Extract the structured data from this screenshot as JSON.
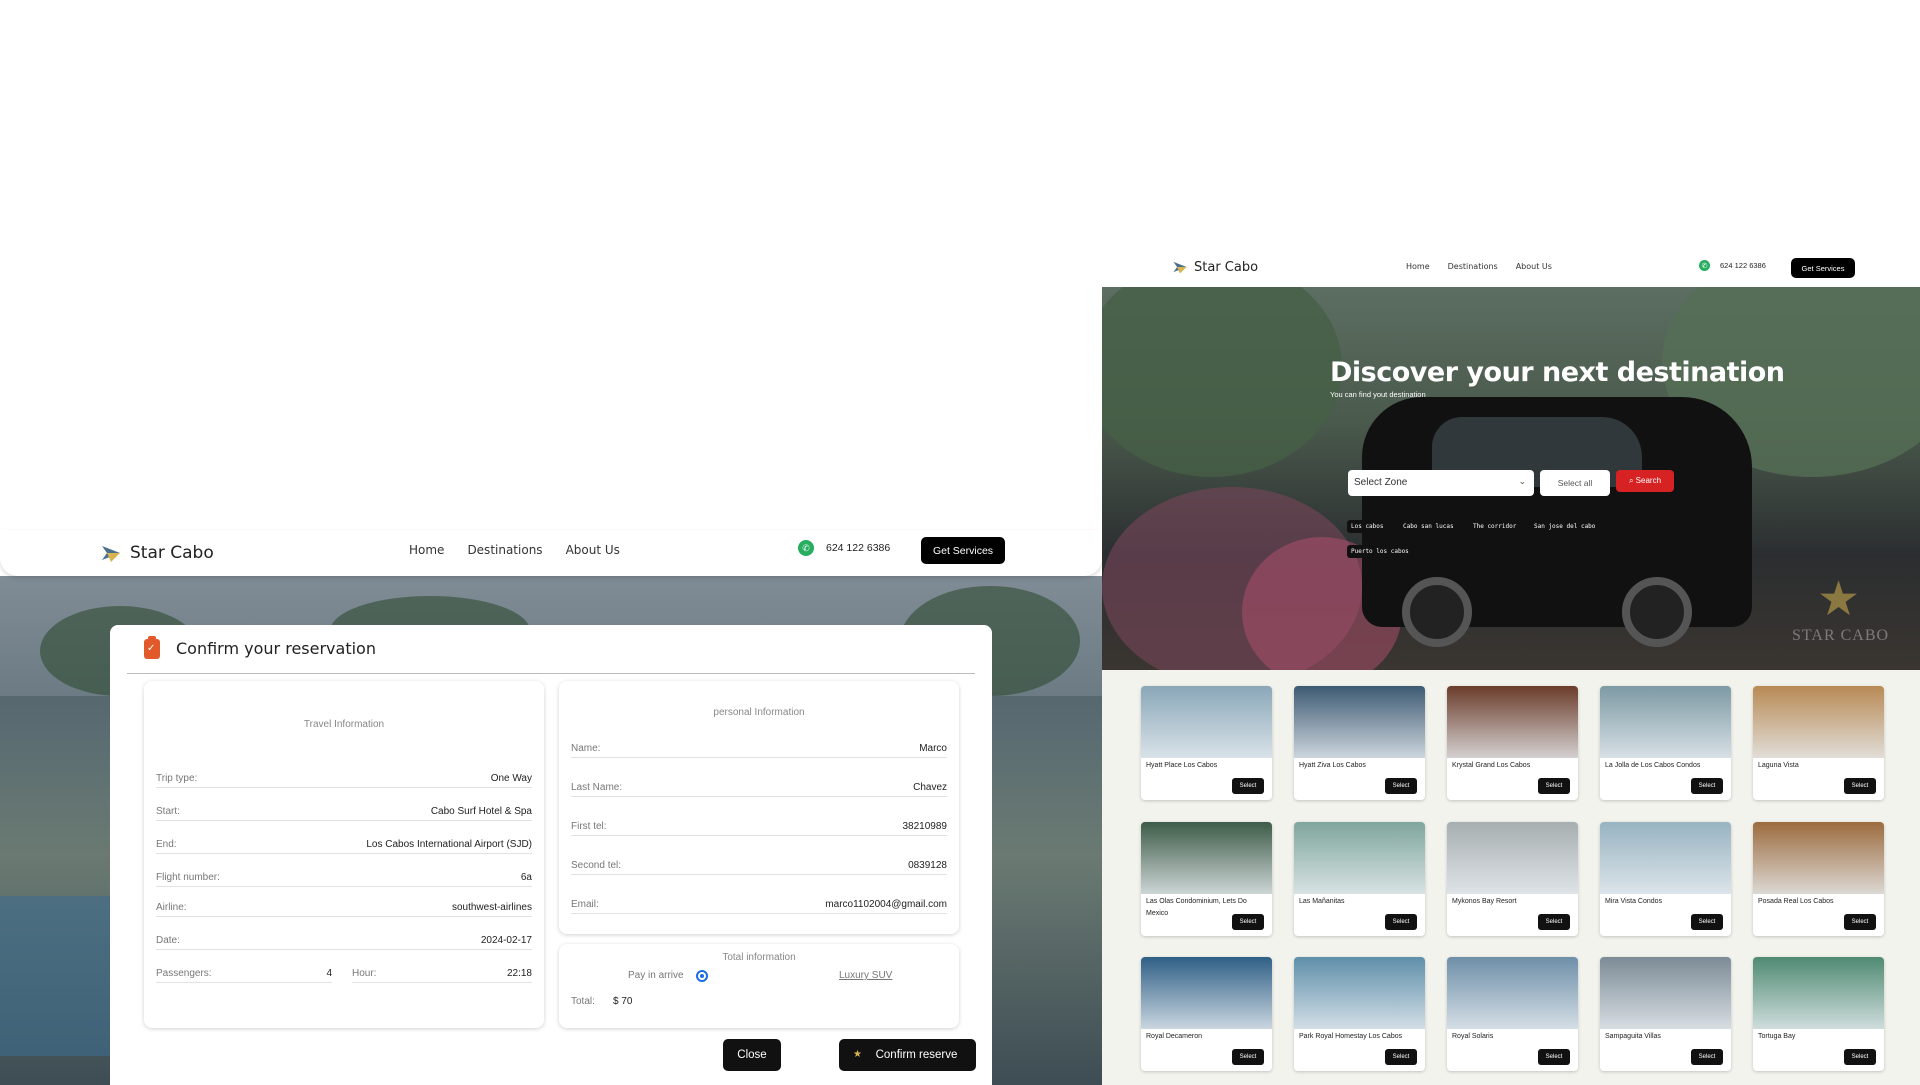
{
  "left": {
    "brand": "Star Cabo",
    "nav": [
      "Home",
      "Destinations",
      "About Us"
    ],
    "phone": "624 122 6386",
    "get_services": "Get Services",
    "modal": {
      "title": "Confirm your reservation",
      "travel": {
        "title": "Travel Information",
        "trip_type": {
          "k": "Trip type:",
          "v": "One Way"
        },
        "start": {
          "k": "Start:",
          "v": "Cabo Surf Hotel & Spa"
        },
        "end": {
          "k": "End:",
          "v": "Los Cabos International Airport (SJD)"
        },
        "flight": {
          "k": "Flight number:",
          "v": "6a"
        },
        "airline": {
          "k": "Airline:",
          "v": "southwest-airlines"
        },
        "date": {
          "k": "Date:",
          "v": "2024-02-17"
        },
        "passengers": {
          "k": "Passengers:",
          "v": "4"
        },
        "hour": {
          "k": "Hour:",
          "v": "22:18"
        }
      },
      "personal": {
        "title": "personal Information",
        "name": {
          "k": "Name:",
          "v": "Marco"
        },
        "last_name": {
          "k": "Last Name:",
          "v": "Chavez"
        },
        "first_tel": {
          "k": "First tel:",
          "v": "38210989"
        },
        "second_tel": {
          "k": "Second tel:",
          "v": "0839128"
        },
        "email": {
          "k": "Email:",
          "v": "marco1102004@gmail.com"
        }
      },
      "total": {
        "title": "Total information",
        "pay_label": "Pay in arrive",
        "vehicle": "Luxury SUV",
        "total_label": "Total:",
        "total_value": "$ 70"
      },
      "close": "Close",
      "confirm": "Confirm reserve"
    }
  },
  "right": {
    "brand": "Star Cabo",
    "nav": [
      "Home",
      "Destinations",
      "About Us"
    ],
    "phone": "624 122 6386",
    "get_services": "Get Services",
    "hero": {
      "title": "Discover your next destination",
      "subtitle": "You can find yout destination",
      "zone_placeholder": "Select Zone",
      "select_all": "Select all",
      "search": "Search",
      "chips": [
        "Los cabos",
        "Cabo san lucas",
        "The corridor",
        "San jose del cabo",
        "Puerto los cabos"
      ],
      "watermark": "STAR CABO"
    },
    "select_label": "Select",
    "hotels": [
      {
        "name": "Hyatt Place Los Cabos",
        "color": "#8aa7b8"
      },
      {
        "name": "Hyatt Ziva Los Cabos",
        "color": "#3d5a73"
      },
      {
        "name": "Krystal Grand Los Cabos",
        "color": "#6b3c2a"
      },
      {
        "name": "La Jolla de Los Cabos Condos",
        "color": "#7d9aa5"
      },
      {
        "name": "Laguna Vista",
        "color": "#b88a55"
      },
      {
        "name": "Las Olas Condominium, Lets Do Mexico",
        "color": "#3d5b48"
      },
      {
        "name": "Las Mañanitas",
        "color": "#7fa69c"
      },
      {
        "name": "Mykonos Bay Resort",
        "color": "#a7aeb0"
      },
      {
        "name": "Mira Vista Condos",
        "color": "#98b3c1"
      },
      {
        "name": "Posada Real Los Cabos",
        "color": "#9c6b3e"
      },
      {
        "name": "Royal Decameron",
        "color": "#2f5f86"
      },
      {
        "name": "Park Royal Homestay Los Cabos",
        "color": "#5f8faa"
      },
      {
        "name": "Royal Solaris",
        "color": "#6e8fa8"
      },
      {
        "name": "Sampaguita Villas",
        "color": "#7c8b96"
      },
      {
        "name": "Tortuga Bay",
        "color": "#4f8a72"
      }
    ]
  }
}
